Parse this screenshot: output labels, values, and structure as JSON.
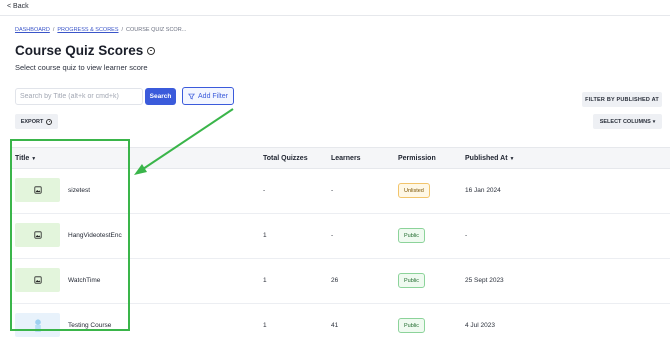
{
  "nav": {
    "back_label": "< Back"
  },
  "breadcrumb": {
    "items": [
      "DASHBOARD",
      "PROGRESS & SCORES",
      "COURSE QUIZ SCOR..."
    ],
    "separator": "/"
  },
  "header": {
    "title": "Course Quiz Scores",
    "subtitle": "Select course quiz to view learner score"
  },
  "toolbar": {
    "search_placeholder": "Search by Title (alt+k or cmd+k)",
    "search_value": "",
    "search_button_label": "Search",
    "add_filter_label": "Add Filter",
    "filter_published_label": "FILTER BY PUBLISHED AT",
    "export_label": "EXPORT",
    "select_columns_label": "SELECT COLUMNS"
  },
  "table": {
    "columns": [
      "Title",
      "Total Quizzes",
      "Learners",
      "Permission",
      "Published At"
    ],
    "rows": [
      {
        "title": "sizetest",
        "total_quizzes": "-",
        "learners": "-",
        "permission": "Unlisted",
        "published_at": "16 Jan 2024"
      },
      {
        "title": "HangVideotestEnc",
        "total_quizzes": "1",
        "learners": "-",
        "permission": "Public",
        "published_at": "-"
      },
      {
        "title": "WatchTime",
        "total_quizzes": "1",
        "learners": "26",
        "permission": "Public",
        "published_at": "25 Sept 2023"
      },
      {
        "title": "Testing Course",
        "total_quizzes": "1",
        "learners": "41",
        "permission": "Public",
        "published_at": "4 Jul 2023"
      }
    ]
  },
  "icons": {
    "info": "info-circle-icon",
    "filter": "funnel-icon",
    "thumbnail": "image-icon",
    "sort": "caret-down-icon"
  },
  "colors": {
    "primary": "#3b5bdb",
    "annotation": "#3ab54a",
    "thumb_bg": "#e3f5dc",
    "unlisted_border": "#f2c46b",
    "public_border": "#8cd39a"
  }
}
